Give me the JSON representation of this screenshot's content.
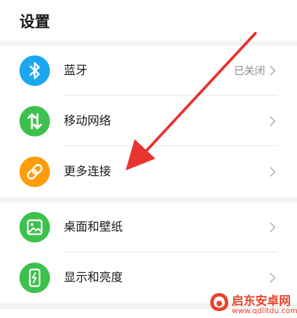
{
  "header": {
    "title": "设置"
  },
  "groups": [
    {
      "rows": [
        {
          "label": "蓝牙",
          "value": "已关闭",
          "icon": "bluetooth-icon",
          "color": "#1aa7f0"
        },
        {
          "label": "移动网络",
          "icon": "mobile-data-icon",
          "color": "#3cc14d"
        },
        {
          "label": "更多连接",
          "icon": "link-icon",
          "color": "#ff9c0a"
        }
      ]
    },
    {
      "rows": [
        {
          "label": "桌面和壁纸",
          "icon": "wallpaper-icon",
          "color": "#3cc14d"
        },
        {
          "label": "显示和亮度",
          "icon": "display-brightness-icon",
          "color": "#3cc14d"
        }
      ]
    }
  ],
  "annotation": {
    "color": "#e8352f"
  },
  "watermark": {
    "text": "启东安卓网",
    "url": "www.qdlitdu.com",
    "color": "#e8452a"
  }
}
